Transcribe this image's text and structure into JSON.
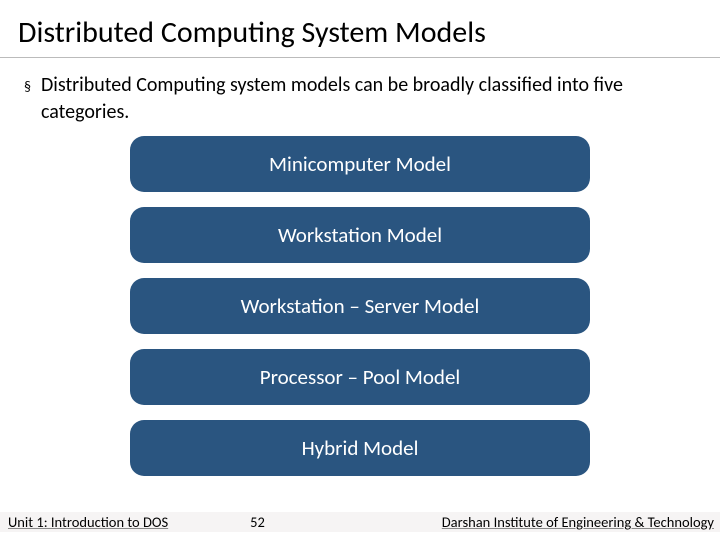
{
  "title": "Distributed Computing System Models",
  "bullet": {
    "mark": "§",
    "text": "Distributed Computing system models can be broadly classified into five categories."
  },
  "models": [
    "Minicomputer Model",
    "Workstation Model",
    "Workstation – Server Model",
    "Processor – Pool Model",
    "Hybrid Model"
  ],
  "footer": {
    "unit": "Unit 1: Introduction to DOS",
    "page": "52",
    "org": "Darshan Institute of Engineering & Technology"
  }
}
